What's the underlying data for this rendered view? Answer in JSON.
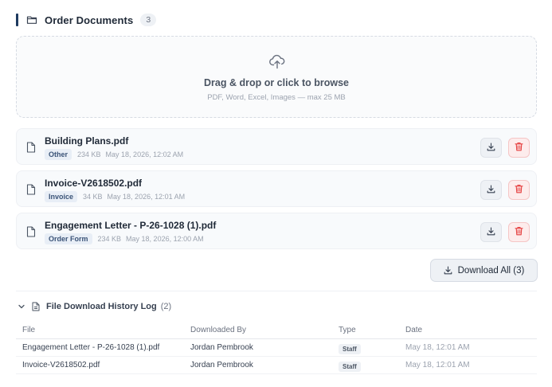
{
  "header": {
    "title": "Order Documents",
    "count": "3"
  },
  "dropzone": {
    "title": "Drag & drop or click to browse",
    "subtitle": "PDF, Word, Excel, Images — max 25 MB"
  },
  "files": [
    {
      "name": "Building Plans.pdf",
      "tag": "Other",
      "size": "234 KB",
      "date": "May 18, 2026, 12:02 AM"
    },
    {
      "name": "Invoice-V2618502.pdf",
      "tag": "Invoice",
      "size": "34 KB",
      "date": "May 18, 2026, 12:01 AM"
    },
    {
      "name": "Engagement Letter - P-26-1028 (1).pdf",
      "tag": "Order Form",
      "size": "234 KB",
      "date": "May 18, 2026, 12:00 AM"
    }
  ],
  "download_all_label": "Download All (3)",
  "history": {
    "title": "File Download History Log",
    "count": "(2)",
    "columns": [
      "File",
      "Downloaded By",
      "Type",
      "Date"
    ],
    "rows": [
      {
        "file": "Engagement Letter - P-26-1028 (1).pdf",
        "by": "Jordan Pembrook",
        "type": "Staff",
        "date": "May 18, 12:01 AM"
      },
      {
        "file": "Invoice-V2618502.pdf",
        "by": "Jordan Pembrook",
        "type": "Staff",
        "date": "May 18, 12:01 AM"
      }
    ]
  },
  "colors": {
    "accent": "#1e3a5f",
    "danger": "#e53e3e",
    "tag_bg": "#e8eef6"
  },
  "icons": {
    "header": "folder-icon",
    "upload": "cloud-upload-icon",
    "file": "file-icon",
    "download": "download-icon",
    "delete": "trash-icon",
    "collapse": "chevron-down-icon",
    "history": "document-icon"
  }
}
